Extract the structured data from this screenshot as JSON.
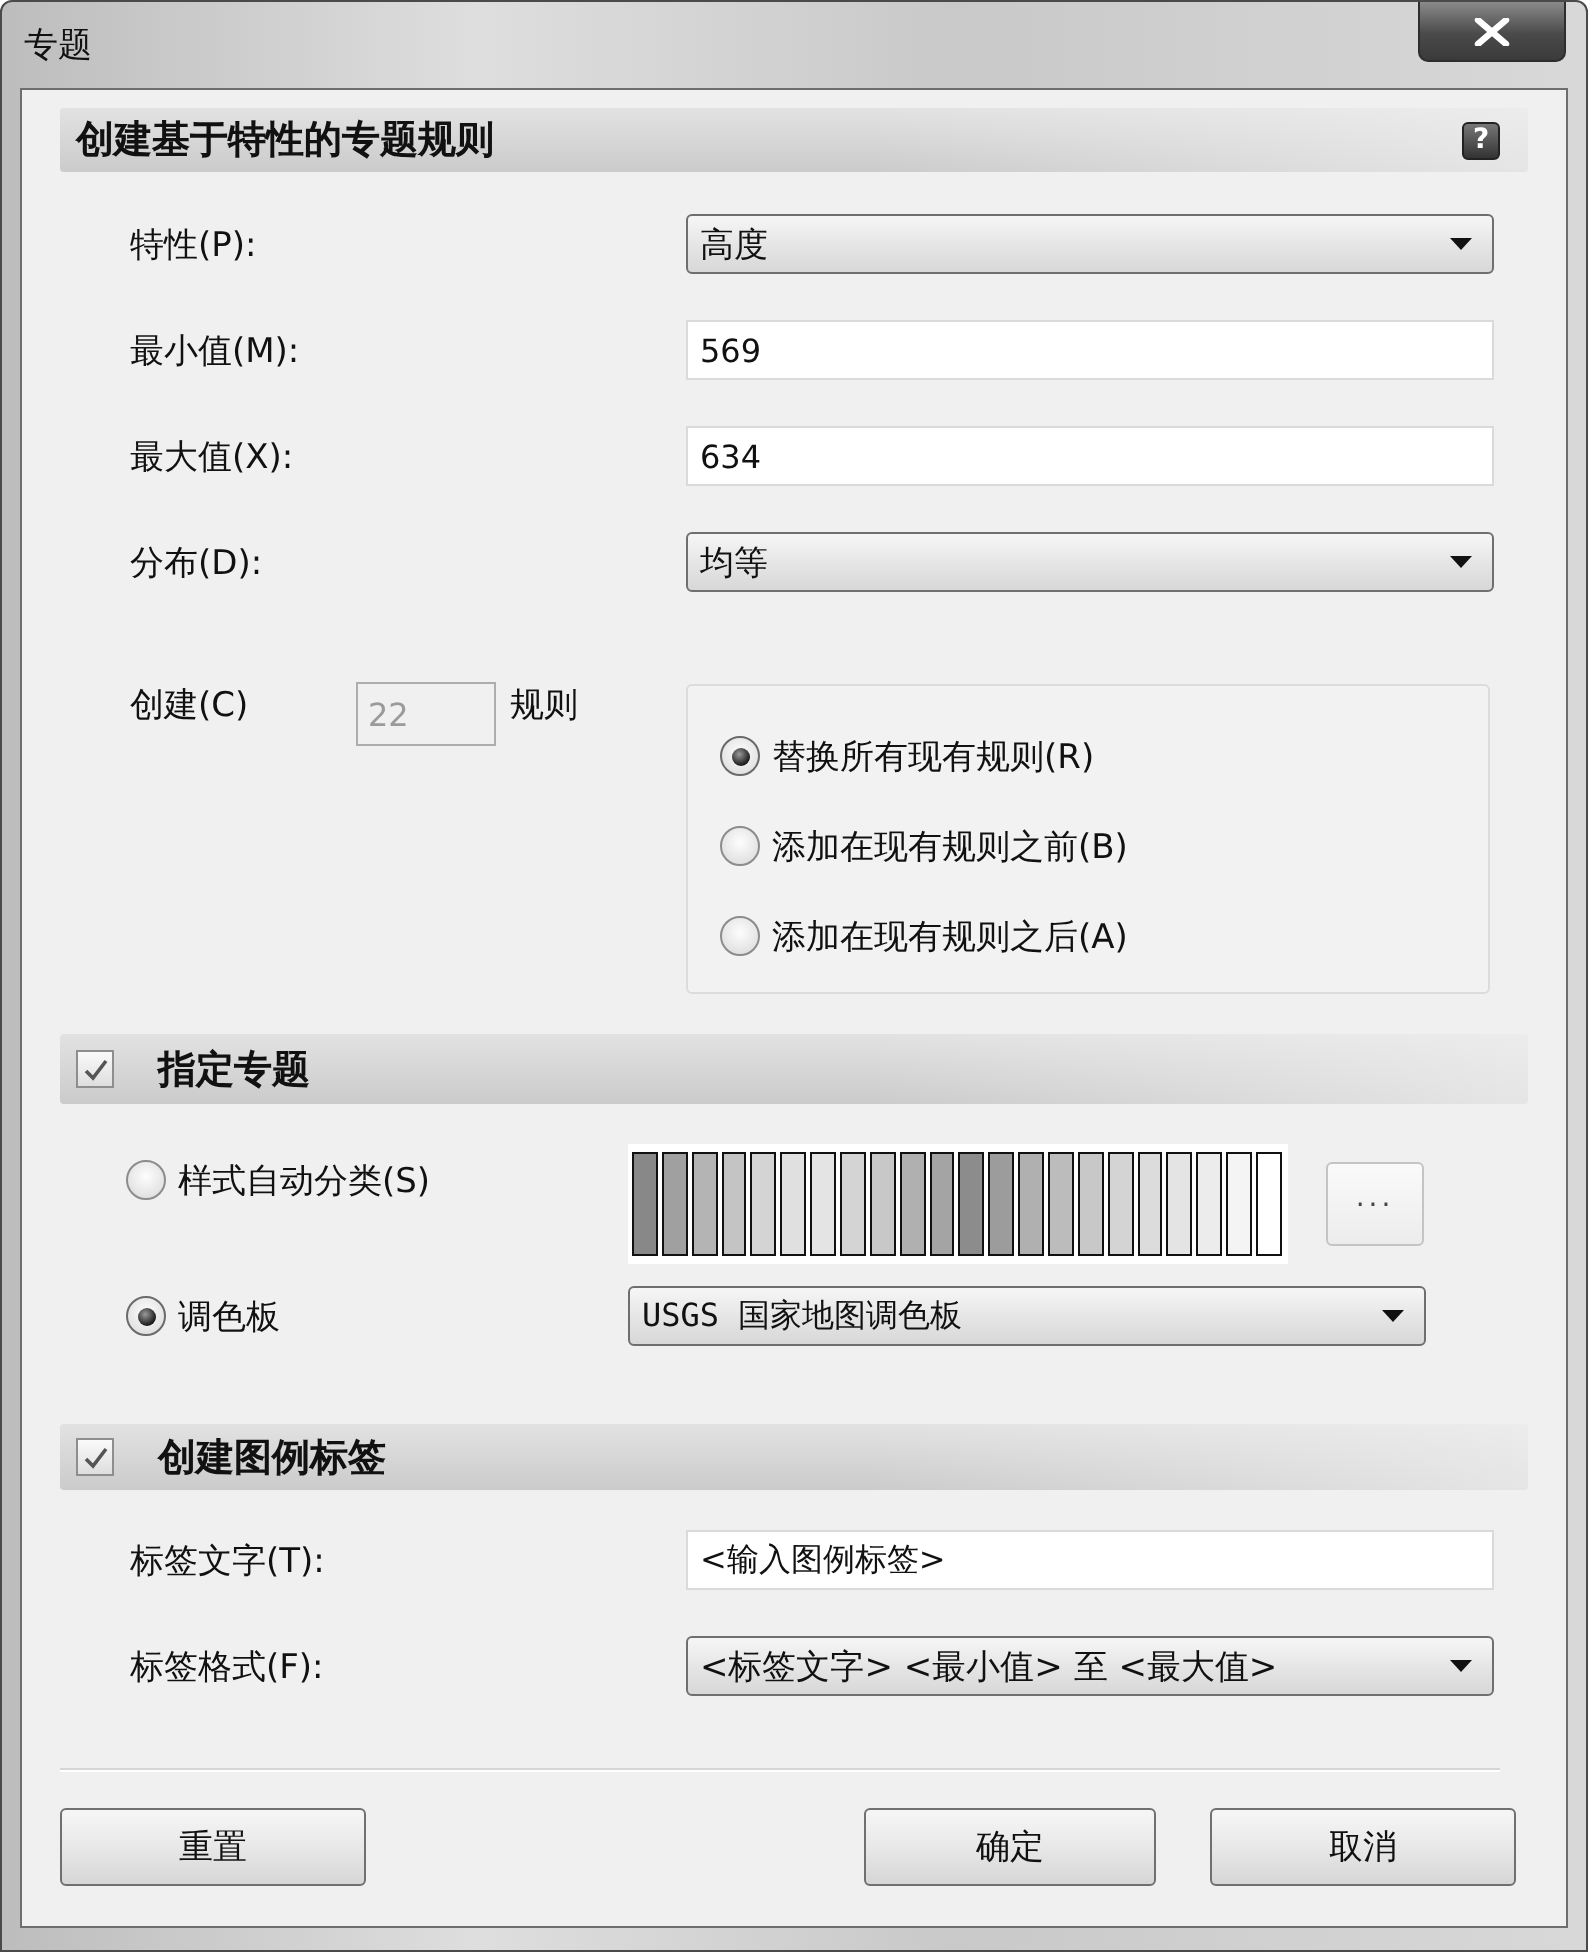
{
  "window": {
    "title": "专题"
  },
  "rules_section": {
    "title": "创建基于特性的专题规则",
    "help_button": "?",
    "fields": [
      {
        "kind": "dropdown",
        "label": "特性(P):",
        "value": "高度"
      },
      {
        "kind": "input",
        "label": "最小值(M):",
        "value": "569"
      },
      {
        "kind": "input",
        "label": "最大值(X):",
        "value": "634"
      },
      {
        "kind": "dropdown",
        "label": "分布(D):",
        "value": "均等"
      }
    ],
    "create": {
      "label": "创建(C)",
      "count": "22",
      "disabled": true,
      "suffix": "规则"
    },
    "rule_mode": [
      {
        "label": "替换所有现有规则(R)",
        "selected": true
      },
      {
        "label": "添加在现有规则之前(B)",
        "selected": false
      },
      {
        "label": "添加在现有规则之后(A)",
        "selected": false
      }
    ]
  },
  "theme_section": {
    "title": "指定专题",
    "checked": true,
    "options": [
      {
        "kind": "ramp",
        "label": "样式自动分类(S)",
        "selected": false,
        "more_button": "...",
        "swatches": [
          {
            "color": "#888888"
          },
          {
            "color": "#a0a0a0"
          },
          {
            "color": "#b4b4b4"
          },
          {
            "color": "#c4c4c4"
          },
          {
            "color": "#d4d4d4"
          },
          {
            "color": "#e0e0e0"
          },
          {
            "color": "#e4e4e4"
          },
          {
            "color": "#d4d4d4"
          },
          {
            "color": "#c8c8c8"
          },
          {
            "color": "#b0b0b0"
          },
          {
            "color": "#a4a4a4"
          },
          {
            "color": "#8c8c8c"
          },
          {
            "color": "#9c9c9c"
          },
          {
            "color": "#b0b0b0"
          },
          {
            "color": "#bcbcbc"
          },
          {
            "color": "#c8c8c8"
          },
          {
            "color": "#d4d4d4"
          },
          {
            "color": "#dcdcdc"
          },
          {
            "color": "#e4e4e4"
          },
          {
            "color": "#ececec"
          },
          {
            "color": "#f4f4f4"
          },
          {
            "color": "#ffffff"
          }
        ]
      },
      {
        "kind": "palette",
        "label": "调色板",
        "selected": true,
        "value": "USGS 国家地图调色板"
      }
    ]
  },
  "legend_section": {
    "title": "创建图例标签",
    "checked": true,
    "fields": [
      {
        "kind": "input",
        "label": "标签文字(T):",
        "value": "<输入图例标签>"
      },
      {
        "kind": "dropdown",
        "label": "标签格式(F):",
        "value": "<标签文字> <最小值> 至 <最大值>"
      }
    ]
  },
  "buttons": [
    "重置",
    "确定",
    "取消"
  ]
}
